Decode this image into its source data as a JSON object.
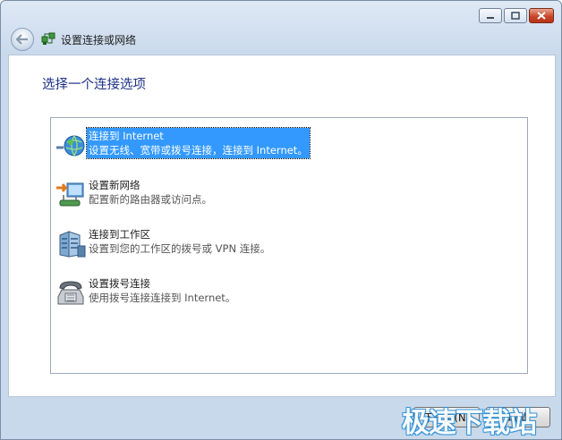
{
  "window": {
    "title": "设置连接或网络",
    "controls": {
      "minimize_icon": "minimize-icon",
      "maximize_icon": "maximize-icon",
      "close_icon": "close-icon"
    }
  },
  "main": {
    "heading": "选择一个连接选项",
    "options": [
      {
        "title": "连接到 Internet",
        "desc": "设置无线、宽带或拨号连接，连接到 Internet。",
        "icon": "globe-network-icon",
        "selected": true
      },
      {
        "title": "设置新网络",
        "desc": "配置新的路由器或访问点。",
        "icon": "router-setup-icon",
        "selected": false
      },
      {
        "title": "连接到工作区",
        "desc": "设置到您的工作区的拨号或 VPN 连接。",
        "icon": "workplace-building-icon",
        "selected": false
      },
      {
        "title": "设置拨号连接",
        "desc": "使用拨号连接连接到 Internet。",
        "icon": "telephone-modem-icon",
        "selected": false
      }
    ]
  },
  "footer": {
    "next_label": "下一步(N)",
    "cancel_label": "取消"
  },
  "watermark": {
    "text": "极速下载站"
  },
  "colors": {
    "selection": "#3399ff",
    "heading": "#1e3287",
    "close_button": "#c9472b"
  }
}
